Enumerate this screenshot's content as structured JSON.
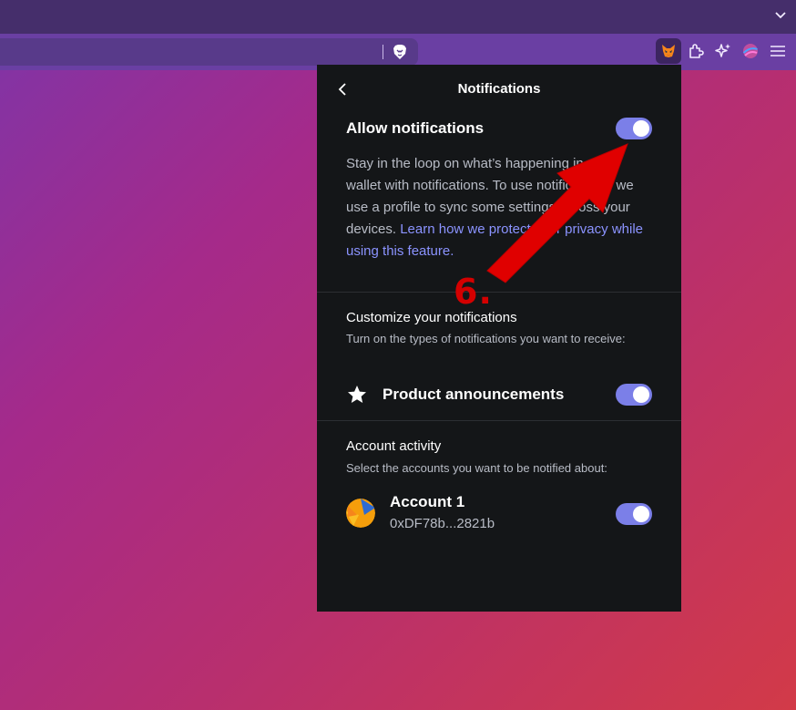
{
  "browser": {
    "tabstrip_chevron_icon": "chevron-down-icon",
    "toolbar_icons": [
      "brave-lion-icon",
      "metamask-fox-icon",
      "extensions-puzzle-icon",
      "leo-ai-icon",
      "wallet-icon",
      "menu-hamburger-icon"
    ]
  },
  "popup": {
    "title": "Notifications",
    "allow": {
      "label": "Allow notifications",
      "enabled": true,
      "desc_text": "Stay in the loop on what’s happening in your wallet with notifications. To use notifications, we use a profile to sync some settings across your devices. ",
      "link_text": "Learn how we protect your privacy while using this feature."
    },
    "customize": {
      "title": "Customize your notifications",
      "subtitle": "Turn on the types of notifications you want to receive:",
      "product_label": "Product announcements",
      "product_enabled": true
    },
    "accounts": {
      "title": "Account activity",
      "subtitle": "Select the accounts you want to be notified about:",
      "list": [
        {
          "name": "Account 1",
          "address": "0xDF78b...2821b",
          "enabled": true
        }
      ]
    }
  },
  "annotation": {
    "step": "6.",
    "color": "#d40000"
  },
  "colors": {
    "accent": "#7b7fe8",
    "link": "#8b93ff",
    "popup_bg": "#141618"
  }
}
